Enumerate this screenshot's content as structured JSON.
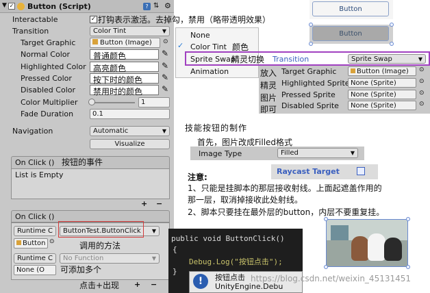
{
  "inspector": {
    "title": "Button (Script)",
    "interactable_label": "Interactable",
    "transition_label": "Transition",
    "transition_value": "Color Tint",
    "target_graphic_label": "Target Graphic",
    "target_graphic_value": "Button (Image)",
    "normal_label": "Normal Color",
    "highlighted_label": "Highlighted Color",
    "pressed_label": "Pressed Color",
    "disabled_label": "Disabled Color",
    "multiplier_label": "Color Multiplier",
    "multiplier_value": "1",
    "fade_label": "Fade Duration",
    "fade_value": "0.1",
    "navigation_label": "Navigation",
    "navigation_value": "Automatic",
    "visualize_label": "Visualize",
    "onclick_label": "On Click ()",
    "list_empty": "List is Empty",
    "onclick2_label": "On Click ()",
    "runtime_label": "Runtime C",
    "function_value": "ButtonTest.ButtonClick",
    "obj_value": "Button",
    "runtime2_label": "Runtime C",
    "nofunction_value": "No Function",
    "none_value": "None (O",
    "plus": "+",
    "minus": "−"
  },
  "annotations": {
    "interactable": "打钩表示激活。去掉勾，禁用（略带透明效果）",
    "normal": "普通颜色",
    "highlighted": "高亮颜色",
    "pressed": "按下时的颜色",
    "disabled": "禁用时的颜色",
    "onclick": "按钮的事件",
    "method": "调用的方法",
    "addmore": "可添加多个",
    "clickplus": "点击+出现",
    "color": "颜色",
    "sprite_swap": "精灵切换",
    "put_sprite": [
      "放入",
      "精灵",
      "图片",
      "即可"
    ],
    "skill_title": "技能按钮的制作",
    "first": "首先，图片改成Filled格式",
    "attention": "注意:",
    "note1a": "1、只能是挂脚本的那层接收射线。上面起遮盖作用的",
    "note1b": "那一层，取消掉接收此处射线。",
    "note2": "2、脚本只要挂在最外层的button，内层不要重复挂。"
  },
  "transition_menu": {
    "items": [
      "None",
      "Color Tint",
      "Sprite Swap",
      "Animation"
    ],
    "checked": "Color Tint"
  },
  "sprite_panel": {
    "transition_label": "Transition",
    "transition_value": "Sprite Swap",
    "target_graphic_label": "Target Graphic",
    "target_graphic_value": "Button (Image)",
    "highlighted_label": "Highlighted Sprite",
    "pressed_label": "Pressed Sprite",
    "disabled_label": "Disabled Sprite",
    "none_sprite": "None (Sprite)"
  },
  "image_type": {
    "label": "Image Type",
    "value": "Filled"
  },
  "raycast": {
    "label": "Raycast Target"
  },
  "button_previews": {
    "label": "Button"
  },
  "code": {
    "line1": "public void ButtonClick()",
    "line2": "{",
    "line3": "Debug.Log(\"按钮点击\");",
    "line4": "}",
    "popup1": "按钮点击",
    "popup2": "UnityEngine.Debu"
  },
  "watermark": "https://blog.csdn.net/weixin_45131451",
  "colors": {
    "highlight_border": "#a040c0",
    "menu_check": "#2a7bd6",
    "raycast_text": "#3a5fbf"
  }
}
